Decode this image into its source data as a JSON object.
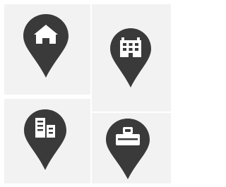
{
  "colors": {
    "background": "#ffffff",
    "tile": "#f2f2f2",
    "pin": "#3a3a3a",
    "glyph": "#ffffff"
  },
  "pins": [
    {
      "icon": "house-icon"
    },
    {
      "icon": "apartment-building-icon"
    },
    {
      "icon": "office-buildings-icon"
    },
    {
      "icon": "id-badge-icon"
    }
  ]
}
